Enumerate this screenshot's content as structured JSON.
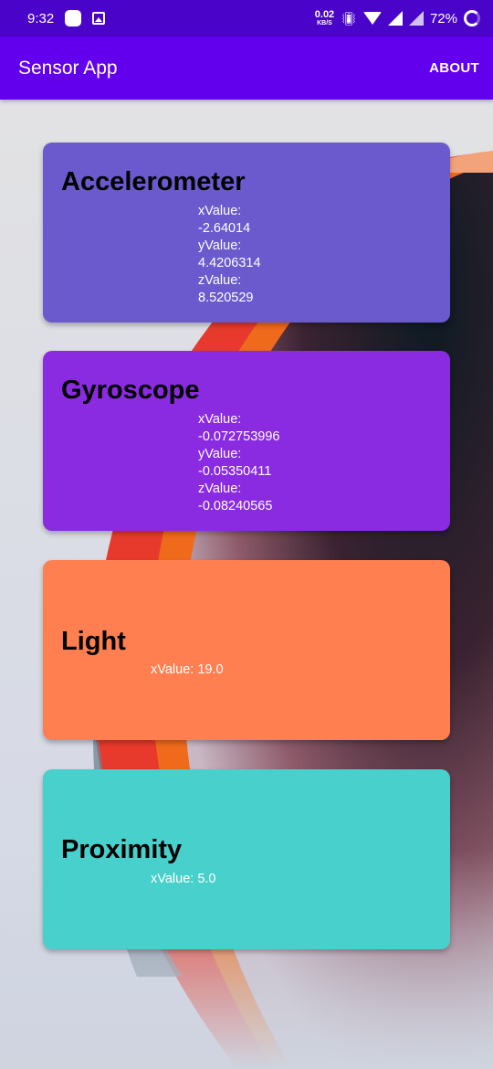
{
  "status_bar": {
    "time": "9:32",
    "net_speed_value": "0.02",
    "net_speed_unit": "KB/S",
    "battery": "72%",
    "icons": [
      "notification-square-icon",
      "image-icon",
      "vibrate-icon",
      "wifi-icon",
      "signal-icon",
      "signal-icon",
      "battery-ring-icon"
    ]
  },
  "app_bar": {
    "title": "Sensor App",
    "about_label": "ABOUT"
  },
  "colors": {
    "status_bar": "#4a04c9",
    "app_bar": "#6200ee",
    "accelerometer_card": "#6a5acd",
    "gyroscope_card": "#8a2be2",
    "light_card": "#ff7f50",
    "proximity_card": "#48d1cc"
  },
  "cards": [
    {
      "name": "Accelerometer",
      "x_label": "xValue:",
      "x_value": "-2.64014",
      "y_label": "yValue:",
      "y_value": "4.4206314",
      "z_label": "zValue:",
      "z_value": "8.520529"
    },
    {
      "name": "Gyroscope",
      "x_label": "xValue:",
      "x_value": "-0.072753996",
      "y_label": "yValue:",
      "y_value": "-0.05350411",
      "z_label": "zValue:",
      "z_value": "-0.08240565"
    },
    {
      "name": "Light",
      "x_text": "xValue: 19.0"
    },
    {
      "name": "Proximity",
      "x_text": "xValue: 5.0"
    }
  ]
}
